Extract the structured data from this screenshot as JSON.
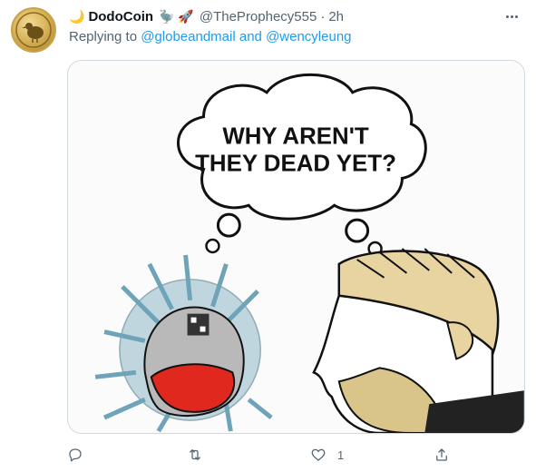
{
  "tweet": {
    "display_name": "DodoCoin",
    "name_prefix_emoji": "🌙",
    "name_suffix_emojis": "🦤 🚀",
    "handle": "@TheProphecy555",
    "separator": "·",
    "timestamp": "2h",
    "replying_to_prefix": "Replying to",
    "reply_user_1": "@globeandmail",
    "reply_joiner": "and",
    "reply_user_2": "@wencyleung",
    "meme_text_line1": "WHY AREN'T",
    "meme_text_line2": "THEY DEAD YET?"
  },
  "actions": {
    "reply_count": "",
    "retweet_count": "",
    "like_count": "1",
    "share_count": ""
  },
  "colors": {
    "link": "#1d9bf0",
    "secondary_text": "#536471",
    "mask_red": "#e0281f",
    "syringe_blue": "#6fa3b8",
    "hair_tan": "#e8d4a0"
  },
  "icons": [
    "more-icon",
    "reply-icon",
    "retweet-icon",
    "like-icon",
    "share-icon"
  ]
}
